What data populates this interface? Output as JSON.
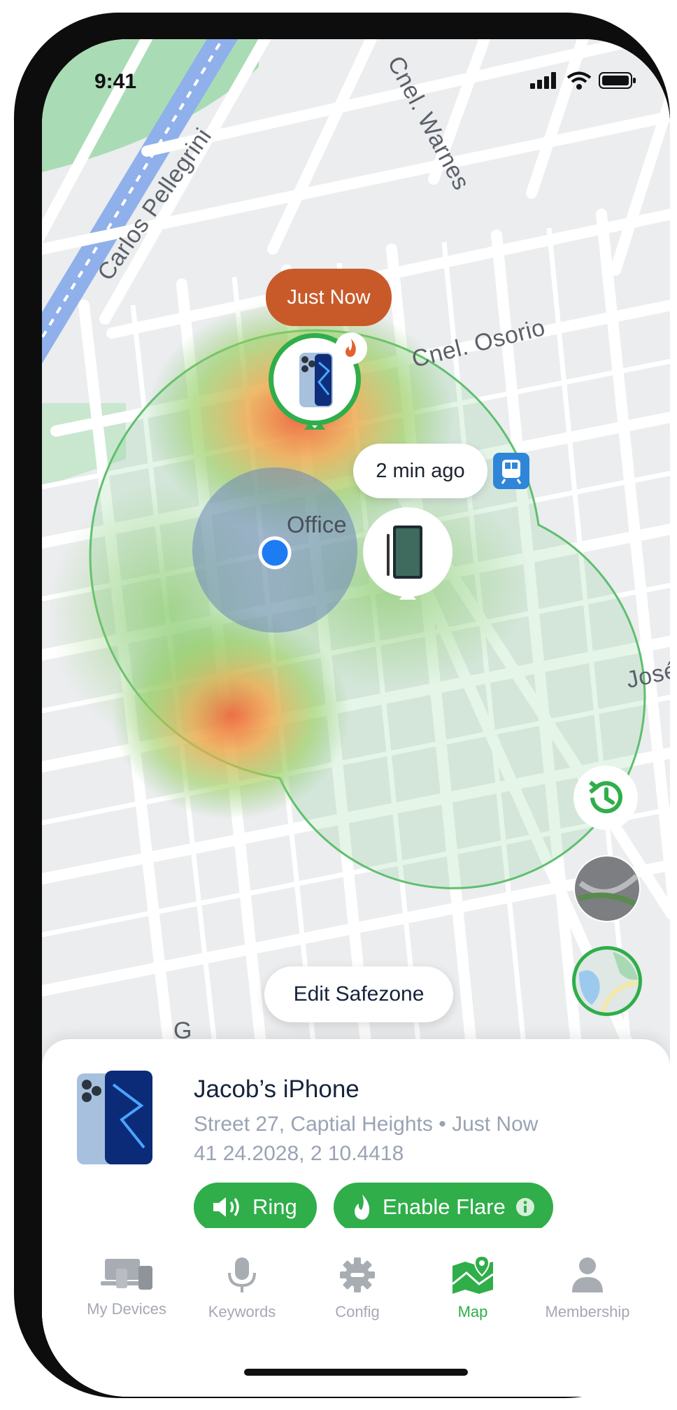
{
  "status_bar": {
    "time": "9:41"
  },
  "map": {
    "streets": [
      "Carlos Pellegrini",
      "Cnel. Warnes",
      "Cnel. Osorio",
      "José",
      "G"
    ],
    "markers": {
      "primary_badge": "Just Now",
      "secondary_badge": "2 min ago",
      "place_label": "Office"
    },
    "edit_safezone_label": "Edit Safezone",
    "colors": {
      "safezone": "#5fbf6e",
      "user_dot": "#1e7cf2",
      "badge": "#c85a2a"
    }
  },
  "device": {
    "name": "Jacob’s iPhone",
    "address": "Street 27, Captial Heights",
    "separator": "•",
    "time": "Just Now",
    "coords": "41 24.2028, 2 10.4418",
    "ring_label": "Ring",
    "flare_label": "Enable Flare"
  },
  "nav": {
    "items": [
      {
        "label": "My Devices",
        "icon": "devices-icon"
      },
      {
        "label": "Keywords",
        "icon": "microphone-icon"
      },
      {
        "label": "Config",
        "icon": "gear-icon"
      },
      {
        "label": "Map",
        "icon": "map-pin-icon"
      },
      {
        "label": "Membership",
        "icon": "person-icon"
      }
    ],
    "active": "Map",
    "active_color": "#2fae4a"
  }
}
